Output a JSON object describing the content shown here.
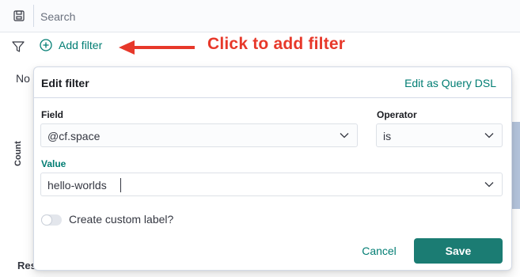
{
  "search": {
    "placeholder": "Search"
  },
  "filters": {
    "add_label": "Add filter"
  },
  "annotation": {
    "text": "Click to add filter",
    "color": "#e7382a"
  },
  "background": {
    "partial_text": "No",
    "chart_axis_label": "Count",
    "partial_bottom_text": "Res"
  },
  "edit_filter": {
    "title": "Edit filter",
    "dsl_link": "Edit as Query DSL",
    "field": {
      "label": "Field",
      "value": "@cf.space"
    },
    "operator": {
      "label": "Operator",
      "value": "is"
    },
    "value": {
      "label": "Value",
      "input": "hello-worlds"
    },
    "custom_label_toggle": {
      "label": "Create custom label?",
      "checked": false
    },
    "cancel_label": "Cancel",
    "save_label": "Save"
  },
  "colors": {
    "accent": "#017d73",
    "primary_button": "#1b7c73",
    "annotation": "#e7382a"
  }
}
